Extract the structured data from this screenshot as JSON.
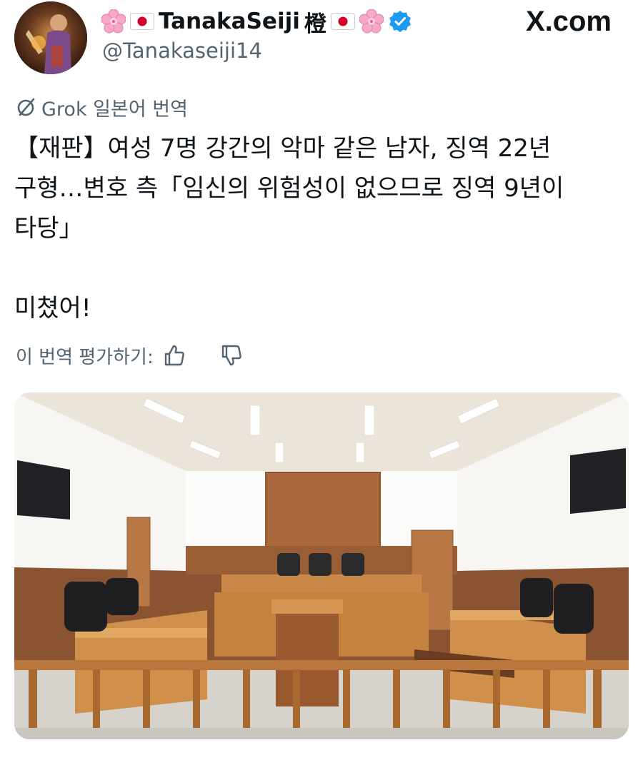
{
  "header": {
    "display_name": "TanakaSeiji",
    "name_suffix_glyph": "橙",
    "handle": "@Tanakaseiji14",
    "brand": "X.com",
    "emoji_left": "cherry-blossom",
    "emoji_right": "cherry-blossom",
    "flag": "japan-flag",
    "verified_color": "#1d9bf0"
  },
  "translation": {
    "label": "Grok 일본어 번역",
    "text": "【재판】여성 7명 강간의 악마 같은 남자, 징역 22년 구형…변호 측「임신의 위험성이 없으므로 징역 9년이 타당」\n\n미쳤어!",
    "rate_label": "이 번역 평가하기:"
  },
  "colors": {
    "text": "#0f1419",
    "secondary": "#536471",
    "wood": "#a86a3a"
  },
  "media": {
    "scene": "courtroom-photo"
  }
}
